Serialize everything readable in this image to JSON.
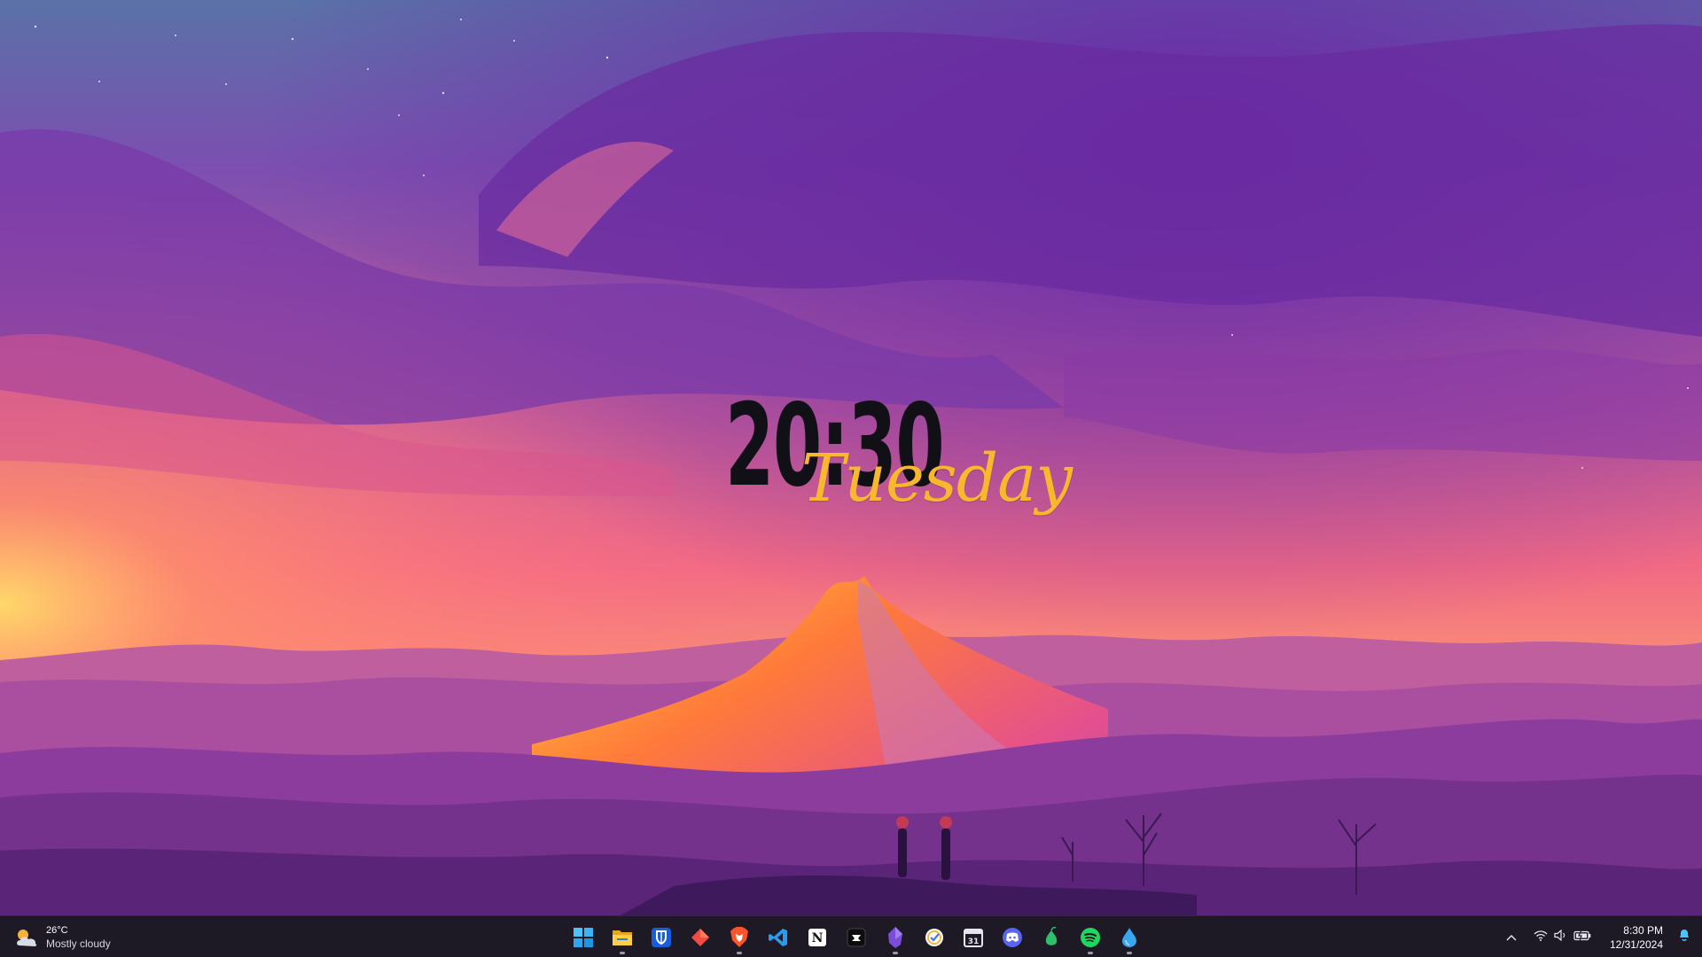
{
  "widget": {
    "time": "20:30",
    "day": "Tuesday"
  },
  "taskbar": {
    "weather": {
      "icon": "partly-cloudy-icon",
      "temperature": "26°C",
      "condition": "Mostly cloudy"
    },
    "apps": [
      {
        "icon": "windows-start-icon",
        "running": false
      },
      {
        "icon": "file-explorer-icon",
        "running": true
      },
      {
        "icon": "bitwarden-icon",
        "running": false
      },
      {
        "icon": "red-diamond-app-icon",
        "running": false
      },
      {
        "icon": "brave-browser-icon",
        "running": true
      },
      {
        "icon": "vscode-icon",
        "running": false
      },
      {
        "icon": "notion-icon",
        "running": false
      },
      {
        "icon": "dark-app-icon",
        "running": false
      },
      {
        "icon": "obsidian-icon",
        "running": true
      },
      {
        "icon": "ticktick-icon",
        "running": false
      },
      {
        "icon": "calendar-icon",
        "running": false
      },
      {
        "icon": "discord-icon",
        "running": false
      },
      {
        "icon": "green-pear-icon",
        "running": false
      },
      {
        "icon": "spotify-icon",
        "running": true
      },
      {
        "icon": "droplet-icon",
        "running": true
      }
    ],
    "calendar_day": "31",
    "tray": {
      "time": "8:30 PM",
      "date": "12/31/2024"
    }
  },
  "colors": {
    "taskbar_bg": "#1d1a26",
    "clock_day": "#f7b72e",
    "clock_time": "#111016"
  }
}
